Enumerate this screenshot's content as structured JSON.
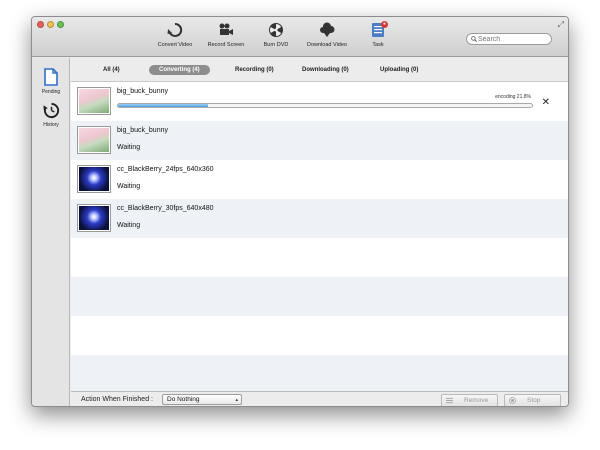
{
  "toolbar": {
    "buttons": [
      {
        "label": "Convert Video",
        "icon": "convert-icon"
      },
      {
        "label": "Record Screen",
        "icon": "record-camera-icon"
      },
      {
        "label": "Burn DVD",
        "icon": "burn-dvd-icon"
      },
      {
        "label": "Download Video",
        "icon": "download-cloud-icon"
      },
      {
        "label": "Task",
        "icon": "task-list-icon",
        "badge": "●"
      }
    ],
    "search_placeholder": "Search"
  },
  "sidebar": {
    "items": [
      {
        "label": "Pending",
        "icon": "document-icon"
      },
      {
        "label": "History",
        "icon": "history-clock-icon"
      }
    ]
  },
  "tabs": [
    {
      "label": "All (4)"
    },
    {
      "label": "Converting (4)",
      "active": true
    },
    {
      "label": "Recording (0)"
    },
    {
      "label": "Downloading (0)"
    },
    {
      "label": "Uploading (0)"
    }
  ],
  "tasks": [
    {
      "title": "big_buck_bunny",
      "status": "",
      "progress_percent": 21.8,
      "progress_text": "encoding 21.8%"
    },
    {
      "title": "big_buck_bunny",
      "status": "Waiting"
    },
    {
      "title": "cc_BlackBerry_24fps_640x360",
      "status": "Waiting"
    },
    {
      "title": "cc_BlackBerry_30fps_640x480",
      "status": "Waiting"
    }
  ],
  "footer": {
    "action_label": "Action When Finished :",
    "action_value": "Do Nothing",
    "remove_label": "Remove",
    "stop_label": "Stop"
  },
  "colors": {
    "progress_fill": "#4a9fe3",
    "active_tab": "#8d8d8d",
    "alt_row": "#eef2f7",
    "badge": "#e0352f"
  }
}
